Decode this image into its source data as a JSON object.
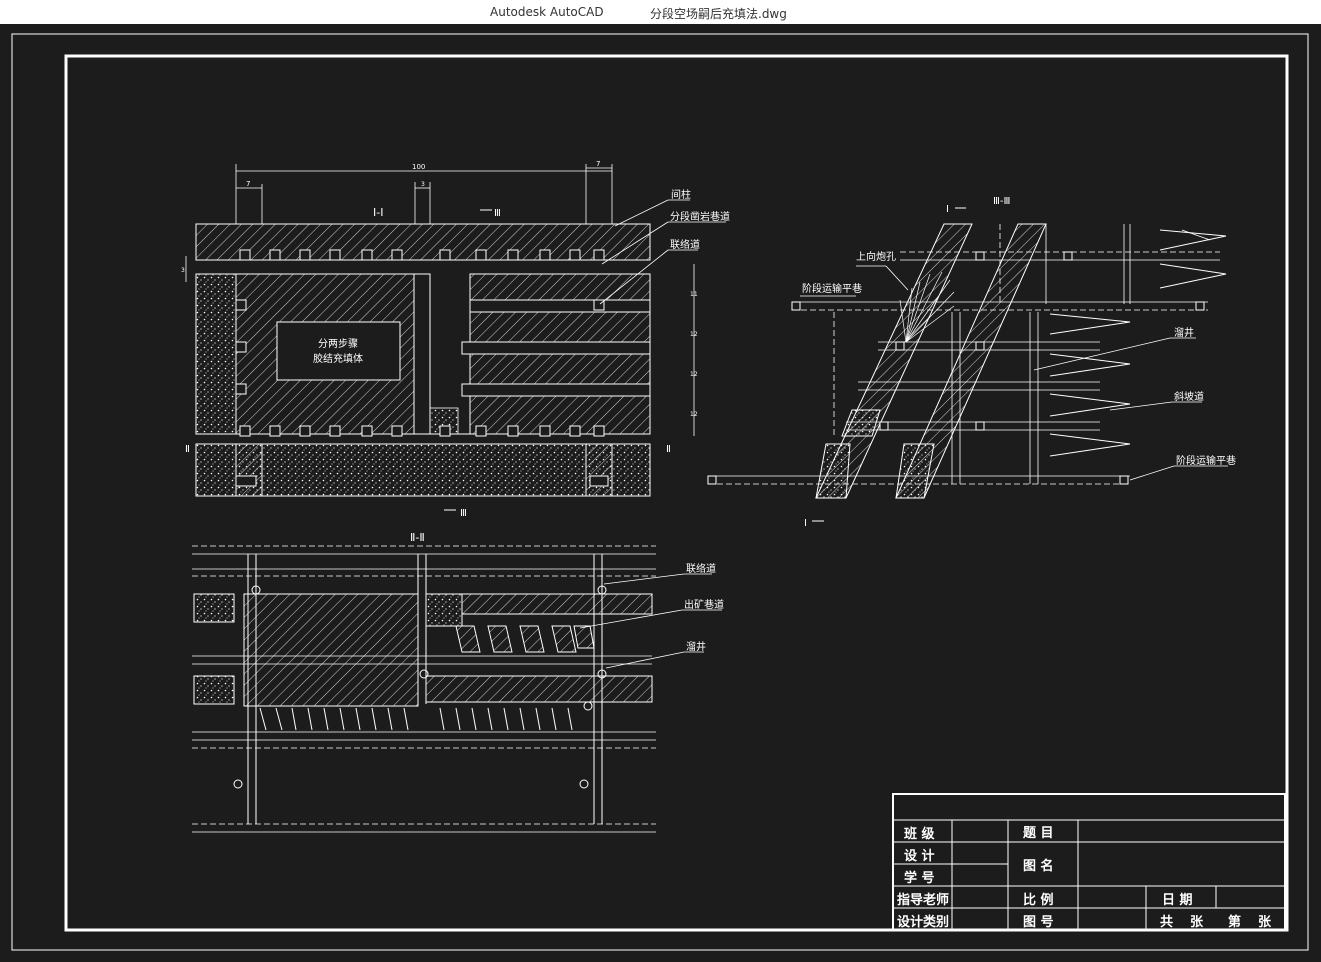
{
  "window": {
    "app_name": "Autodesk AutoCAD",
    "document_name": "分段空场嗣后充填法.dwg"
  },
  "colors": {
    "background": "#1c1c1c",
    "line": "#ffffff",
    "titlebar": "#ffffff"
  },
  "drawing": {
    "section_1": {
      "title": "Ⅰ-Ⅰ",
      "cut_label_top": "Ⅲ",
      "cut_label_bottom": "Ⅲ",
      "cut_label_left": "Ⅱ",
      "cut_label_right": "Ⅱ",
      "dim_top": "100",
      "dim_left": "7",
      "dim_right": "7",
      "dim_mid": "3",
      "dim_side": "3",
      "right_dims": [
        "11",
        "12",
        "12",
        "12"
      ],
      "box_text_1": "分两步骤",
      "box_text_2": "胶结充填体",
      "callouts": [
        "间柱",
        "分段凿岩巷道",
        "联络道"
      ]
    },
    "section_2": {
      "title": "Ⅱ-Ⅱ",
      "callouts": [
        "联络道",
        "出矿巷道",
        "溜井"
      ]
    },
    "section_3": {
      "title": "Ⅲ-Ⅲ",
      "cut_label_top": "Ⅰ",
      "cut_label_bottom": "Ⅰ",
      "callouts": [
        "上向炮孔",
        "阶段运输平巷",
        "溜井",
        "斜坡道",
        "阶段运输平巷"
      ]
    }
  },
  "title_block": {
    "class_label": "班 级",
    "design_label": "设 计",
    "student_id_label": "学 号",
    "advisor_label": "指导老师",
    "design_type_label": "设计类别",
    "subject_label": "题 目",
    "drawing_name_label": "图 名",
    "scale_label": "比 例",
    "drawing_no_label": "图 号",
    "date_label": "日 期",
    "sheets_total_label": "共",
    "sheets_unit_1": "张",
    "sheets_index_label": "第",
    "sheets_unit_2": "张"
  }
}
